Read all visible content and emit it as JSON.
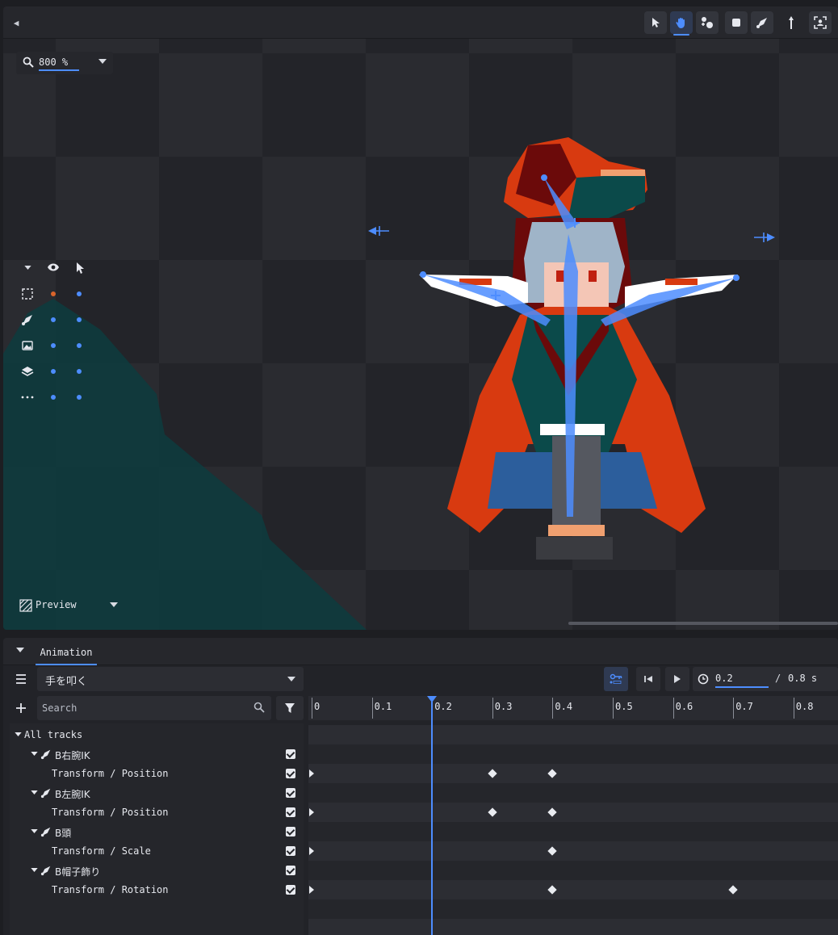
{
  "viewport": {
    "zoom": {
      "value": "800 %"
    },
    "preview": {
      "label": "Preview"
    },
    "toolbar": [
      "select-tool",
      "pan-tool",
      "bone-add-tool",
      "rectangle-tool",
      "bone-tool",
      "pivot-tool",
      "focus-tool"
    ],
    "active_tool": "pan-tool",
    "layer_tools": {
      "header_icons": [
        "chevron-down-icon",
        "eye-icon",
        "cursor-icon"
      ],
      "rows": [
        {
          "icon": "selection-icon",
          "eye_dot": "orange",
          "select_dot": "blue"
        },
        {
          "icon": "bone-icon",
          "eye_dot": "blue",
          "select_dot": "blue"
        },
        {
          "icon": "image-icon",
          "eye_dot": "blue",
          "select_dot": "blue"
        },
        {
          "icon": "layers-icon",
          "eye_dot": "blue",
          "select_dot": "blue"
        },
        {
          "icon": "more-icon",
          "eye_dot": "blue",
          "select_dot": "blue"
        }
      ]
    }
  },
  "animation_panel": {
    "tab_label": "Animation",
    "selected_animation": "手を叩く",
    "search": {
      "placeholder": "Search"
    },
    "time": {
      "current": "0.2",
      "separator": "/",
      "total": "0.8 s"
    },
    "ruler_ticks": [
      "0",
      "0.1",
      "0.2",
      "0.3",
      "0.4",
      "0.5",
      "0.6",
      "0.7",
      "0.8"
    ],
    "playhead_time": 0.2,
    "tracks": {
      "root_label": "All tracks",
      "items": [
        {
          "bone": "B右腕IK",
          "property": "Transform / Position",
          "keyframes": [
            0,
            0.3,
            0.4
          ]
        },
        {
          "bone": "B左腕IK",
          "property": "Transform / Position",
          "keyframes": [
            0,
            0.3,
            0.4
          ]
        },
        {
          "bone": "B頭",
          "property": "Transform / Scale",
          "keyframes": [
            0,
            0.4
          ]
        },
        {
          "bone": "B帽子飾り",
          "property": "Transform / Rotation",
          "keyframes": [
            0,
            0.4,
            0.7
          ]
        }
      ]
    }
  },
  "colors": {
    "accent": "#4d8dff",
    "panel": "#222328",
    "checkbox": "#e9ebf0",
    "sprite_red": "#d83a10",
    "sprite_teal": "#0b4a4a",
    "sprite_blue": "#2c5e9c"
  }
}
